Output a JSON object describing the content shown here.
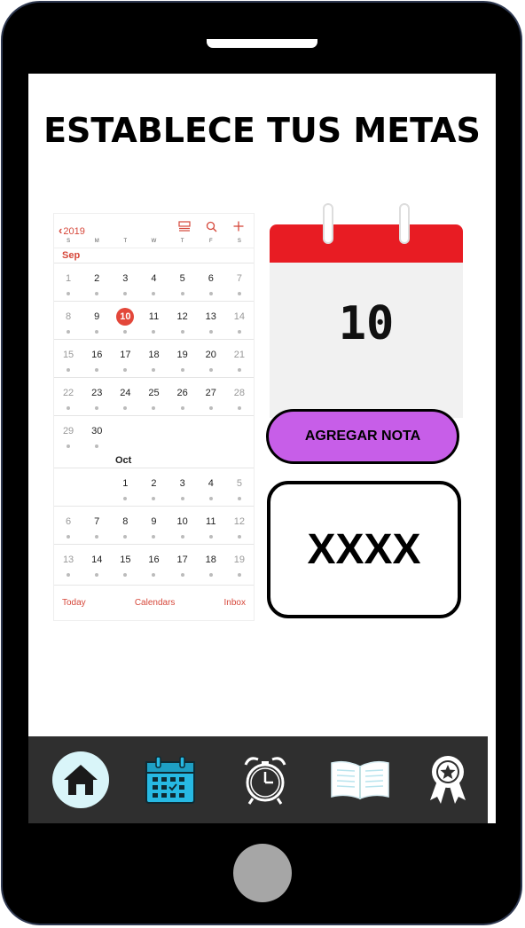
{
  "header": {
    "title": "ESTABLECE TUS METAS"
  },
  "calendar": {
    "year_back": "2019",
    "weekdays": [
      "S",
      "M",
      "T",
      "W",
      "T",
      "F",
      "S"
    ],
    "month_sep": "Sep",
    "month_oct": "Oct",
    "sep_weeks": [
      [
        "1",
        "2",
        "3",
        "4",
        "5",
        "6",
        "7"
      ],
      [
        "8",
        "9",
        "10",
        "11",
        "12",
        "13",
        "14"
      ],
      [
        "15",
        "16",
        "17",
        "18",
        "19",
        "20",
        "21"
      ],
      [
        "22",
        "23",
        "24",
        "25",
        "26",
        "27",
        "28"
      ],
      [
        "29",
        "30",
        "",
        "",
        "",
        "",
        ""
      ]
    ],
    "oct_weeks": [
      [
        "",
        "",
        "1",
        "2",
        "3",
        "4",
        "5"
      ],
      [
        "6",
        "7",
        "8",
        "9",
        "10",
        "11",
        "12"
      ],
      [
        "13",
        "14",
        "15",
        "16",
        "17",
        "18",
        "19"
      ]
    ],
    "today": "10",
    "bottom": {
      "today": "Today",
      "calendars": "Calendars",
      "inbox": "Inbox"
    }
  },
  "date_widget": {
    "day": "10"
  },
  "add_note": {
    "label": "AGREGAR NOTA"
  },
  "note": {
    "text": "XXXX"
  },
  "colors": {
    "accent_red": "#e81c23",
    "button_purple": "#c75ee8",
    "nav_bg": "#2f2f2f",
    "nav_icon": "#27b9e3"
  },
  "nav": {
    "items": [
      "home-icon",
      "calendar-icon",
      "alarm-clock-icon",
      "book-icon",
      "award-ribbon-icon"
    ]
  }
}
